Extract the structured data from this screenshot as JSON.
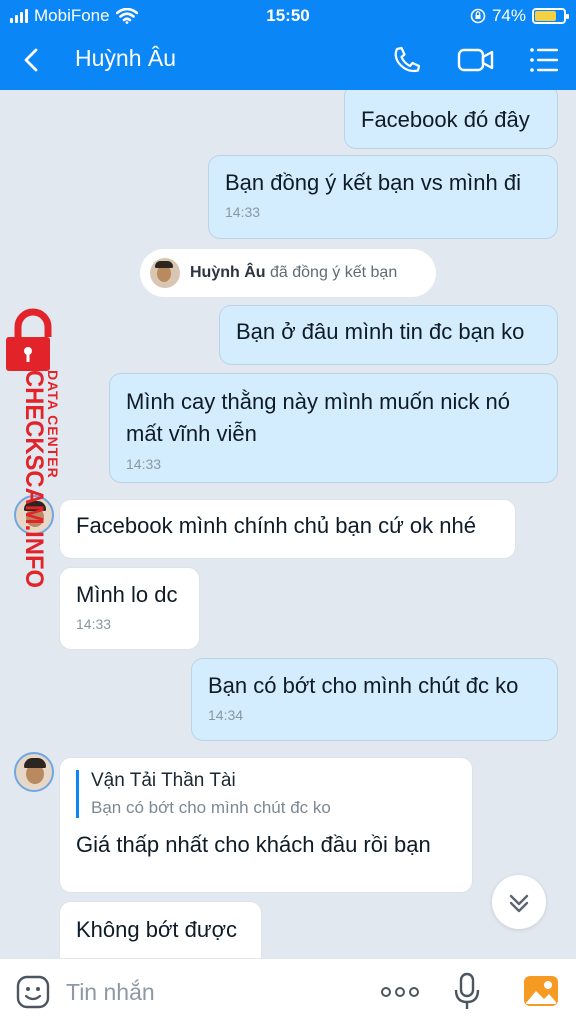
{
  "status_bar": {
    "carrier": "MobiFone",
    "time": "15:50",
    "battery_percent": "74%",
    "battery_level": 0.74
  },
  "header": {
    "contact_name": "Huỳnh Âu",
    "icons": [
      "back-icon",
      "phone-icon",
      "video-icon",
      "menu-icon"
    ]
  },
  "messages": {
    "m1": {
      "text": "Facebook đó đây"
    },
    "m2": {
      "text": "Bạn đồng ý kết bạn vs mình đi",
      "time": "14:33"
    },
    "system": {
      "name": "Huỳnh Âu",
      "action": "đã đồng ý kết bạn"
    },
    "m3": {
      "text": "Bạn ở đâu mình tin đc bạn ko"
    },
    "m4": {
      "text": "Mình cay thằng này mình muốn nick nó mất vĩnh viễn",
      "time": "14:33"
    },
    "m5": {
      "text": "Facebook mình chính chủ bạn cứ ok nhé"
    },
    "m6": {
      "text": "Mình lo dc",
      "time": "14:33"
    },
    "m7": {
      "text": "Bạn có bớt cho mình chút đc ko",
      "time": "14:34"
    },
    "m8": {
      "quote_author": "Vận Tải Thần Tài",
      "quote_text": "Bạn có bớt cho mình chút đc ko",
      "text": "Giá thấp nhất cho khách đầu rồi bạn"
    },
    "m9": {
      "text": "Không bớt được"
    }
  },
  "watermark": {
    "title": "CHECKSCAM.INFO",
    "subtitle": "DATA CENTER"
  },
  "input": {
    "placeholder": "Tin nhắn"
  },
  "colors": {
    "header": "#0a86f7",
    "outgoing": "#d3ecfe",
    "incoming": "#ffffff",
    "watermark": "#e3232a"
  }
}
